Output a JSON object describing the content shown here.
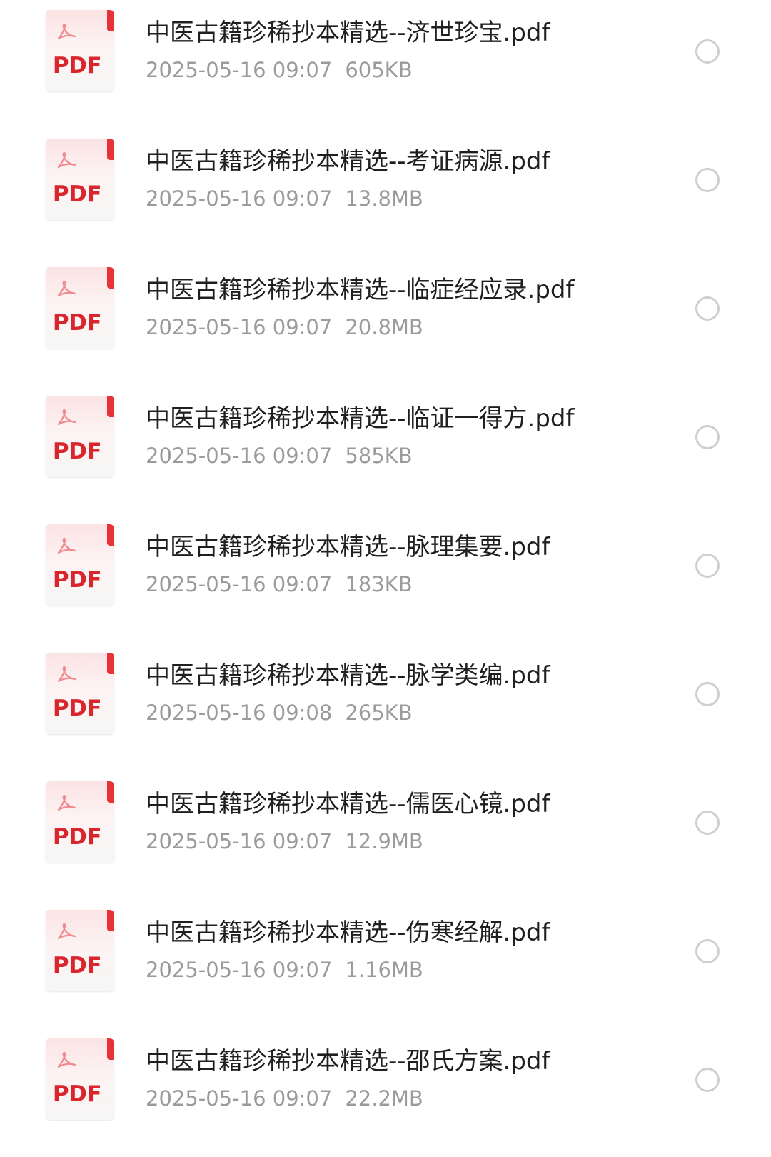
{
  "files": [
    {
      "name": "中医古籍珍稀抄本精选--济世珍宝.pdf",
      "date": "2025-05-16 09:07",
      "size": "605KB",
      "icon_label": "PDF"
    },
    {
      "name": "中医古籍珍稀抄本精选--考证病源.pdf",
      "date": "2025-05-16 09:07",
      "size": "13.8MB",
      "icon_label": "PDF"
    },
    {
      "name": "中医古籍珍稀抄本精选--临症经应录.pdf",
      "date": "2025-05-16 09:07",
      "size": "20.8MB",
      "icon_label": "PDF"
    },
    {
      "name": "中医古籍珍稀抄本精选--临证一得方.pdf",
      "date": "2025-05-16 09:07",
      "size": "585KB",
      "icon_label": "PDF"
    },
    {
      "name": "中医古籍珍稀抄本精选--脉理集要.pdf",
      "date": "2025-05-16 09:07",
      "size": "183KB",
      "icon_label": "PDF"
    },
    {
      "name": "中医古籍珍稀抄本精选--脉学类编.pdf",
      "date": "2025-05-16 09:08",
      "size": "265KB",
      "icon_label": "PDF"
    },
    {
      "name": "中医古籍珍稀抄本精选--儒医心镜.pdf",
      "date": "2025-05-16 09:07",
      "size": "12.9MB",
      "icon_label": "PDF"
    },
    {
      "name": "中医古籍珍稀抄本精选--伤寒经解.pdf",
      "date": "2025-05-16 09:07",
      "size": "1.16MB",
      "icon_label": "PDF"
    },
    {
      "name": "中医古籍珍稀抄本精选--邵氏方案.pdf",
      "date": "2025-05-16 09:07",
      "size": "22.2MB",
      "icon_label": "PDF"
    }
  ],
  "colors": {
    "pdf_red": "#d9262d",
    "title_text": "#1f1f1f",
    "meta_text": "#9b9b9b",
    "radio_border": "#cfcfcf"
  },
  "icons": {
    "file_type": "pdf-file-icon",
    "selector": "radio-unchecked-icon"
  }
}
